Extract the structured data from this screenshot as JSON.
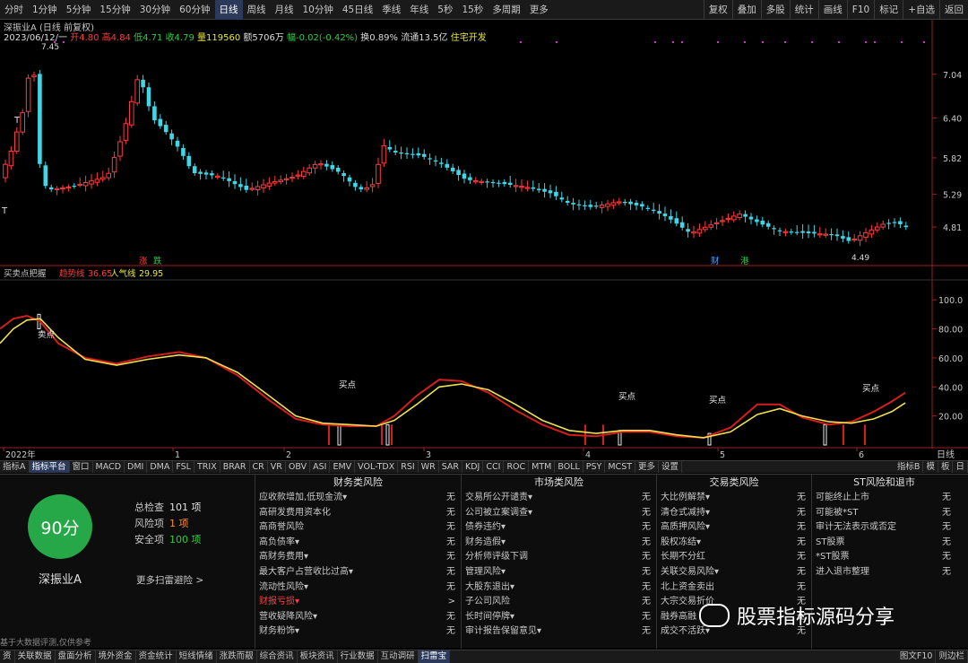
{
  "toolbar": {
    "periods": [
      "分时",
      "1分钟",
      "5分钟",
      "15分钟",
      "30分钟",
      "60分钟",
      "日线",
      "周线",
      "月线",
      "10分钟",
      "45日线",
      "季线",
      "年线",
      "5秒",
      "15秒",
      "多周期",
      "更多"
    ],
    "active_period": "日线",
    "right_tools": [
      "复权",
      "叠加",
      "多股",
      "统计",
      "画线",
      "F10",
      "标记",
      "+自选",
      "返回"
    ]
  },
  "quote": {
    "stock_name": "深振业A",
    "chart_mode": "(日线 前复权)",
    "date": "2023/06/12/一",
    "open": "开4.80",
    "high": "高4.84",
    "low": "低4.71",
    "close": "收4.79",
    "volume": "量119560",
    "amount": "额5706万",
    "change": "幅-0.02(-0.42%)",
    "turnover": "换0.89%",
    "float_cap": "流通13.5亿",
    "sector": "住宅开发"
  },
  "main_chart": {
    "price_ticks": [
      "7.04",
      "6.40",
      "5.82",
      "5.29",
      "4.81"
    ],
    "high_mark": "7.45",
    "low_mark": "4.49",
    "badges": [
      "涨",
      "跌",
      "财",
      "港"
    ],
    "t_marker": "T",
    "x_labels": [
      "2022年",
      "1",
      "2",
      "3",
      "4",
      "5",
      "6"
    ],
    "right_bottom": "日线"
  },
  "indicator": {
    "name": "买卖点把握",
    "line1_label": "趋势线",
    "line1_value": "36.65",
    "line2_label": "人气线",
    "line2_value": "29.95",
    "ticks": [
      "100.0",
      "80.00",
      "60.00",
      "40.00",
      "20.00"
    ],
    "sell_label": "卖点",
    "buy_label": "买点"
  },
  "indicator_tabs": [
    "指标A",
    "指标平台",
    "窗口",
    "MACD",
    "DMI",
    "DMA",
    "FSL",
    "TRIX",
    "BRAR",
    "CR",
    "VR",
    "OBV",
    "ASI",
    "EMV",
    "VOL-TDX",
    "RSI",
    "WR",
    "SAR",
    "KDJ",
    "CCI",
    "ROC",
    "MTM",
    "BOLL",
    "PSY",
    "MCST",
    "更多",
    "设置"
  ],
  "indicator_tabs_active": "指标平台",
  "indicator_right": [
    "指标B",
    "模",
    "板",
    "日"
  ],
  "risk": {
    "score": "90分",
    "stock": "深振业A",
    "total_label": "总检查",
    "total_value": "101 项",
    "risk_label": "风险项",
    "risk_value": "1 项",
    "safe_label": "安全项",
    "safe_value": "100 项",
    "more_scan": "更多扫雷避险 >",
    "disclaimer": "基于大数据评测,仅供参考",
    "columns": [
      {
        "title": "财务类风险",
        "rows": [
          {
            "name": "应收款增加,低现金流▾",
            "value": "无"
          },
          {
            "name": "高研发费用资本化",
            "value": "无"
          },
          {
            "name": "高商誉风险",
            "value": "无"
          },
          {
            "name": "高负债率▾",
            "value": "无"
          },
          {
            "name": "高财务费用▾",
            "value": "无"
          },
          {
            "name": "最大客户占营收比过高▾",
            "value": "无"
          },
          {
            "name": "流动性风险▾",
            "value": "无"
          },
          {
            "name": "财报亏损▾",
            "value": ">"
          },
          {
            "name": "营收疑降风险▾",
            "value": "无"
          },
          {
            "name": "财务粉饰▾",
            "value": "无"
          }
        ]
      },
      {
        "title": "市场类风险",
        "rows": [
          {
            "name": "交易所公开谴责▾",
            "value": "无"
          },
          {
            "name": "公司被立案调查▾",
            "value": "无"
          },
          {
            "name": "债券违约▾",
            "value": "无"
          },
          {
            "name": "财务造假▾",
            "value": "无"
          },
          {
            "name": "分析师评级下调",
            "value": "无"
          },
          {
            "name": "管理风险▾",
            "value": "无"
          },
          {
            "name": "大股东退出▾",
            "value": "无"
          },
          {
            "name": "子公司风险",
            "value": "无"
          },
          {
            "name": "长时间停牌▾",
            "value": "无"
          },
          {
            "name": "审计报告保留意见▾",
            "value": "无"
          }
        ]
      },
      {
        "title": "交易类风险",
        "rows": [
          {
            "name": "大比例解禁▾",
            "value": "无"
          },
          {
            "name": "清仓式减持▾",
            "value": "无"
          },
          {
            "name": "高质押风险▾",
            "value": "无"
          },
          {
            "name": "股权冻结▾",
            "value": "无"
          },
          {
            "name": "长期不分红",
            "value": "无"
          },
          {
            "name": "关联交易风险▾",
            "value": "无"
          },
          {
            "name": "北上资金卖出",
            "value": "无"
          },
          {
            "name": "大宗交易折价",
            "value": "无"
          },
          {
            "name": "融券高融",
            "value": "无"
          },
          {
            "name": "成交不活跃▾",
            "value": "无"
          }
        ]
      },
      {
        "title": "ST风险和退市",
        "rows": [
          {
            "name": "可能终止上市",
            "value": "无"
          },
          {
            "name": "可能被*ST",
            "value": "无"
          },
          {
            "name": "审计无法表示或否定",
            "value": "无"
          },
          {
            "name": "ST股票",
            "value": "无"
          },
          {
            "name": "*ST股票",
            "value": "无"
          },
          {
            "name": "进入退市整理",
            "value": "无"
          }
        ]
      }
    ]
  },
  "watermark": "股票指标源码分享",
  "statusbar": {
    "items": [
      "资",
      "关联数据",
      "盘面分析",
      "境外资金",
      "资金统计",
      "短线情绪",
      "涨跌而靓",
      "综合资讯",
      "板块资讯",
      "行业数据",
      "互动调研",
      "扫雷宝"
    ],
    "active": "扫雷宝",
    "right": [
      "图文F10",
      "则边栏"
    ]
  },
  "colors": {
    "up": "#ff3c3c",
    "down": "#3fd6e6",
    "trend": "#d41e1e",
    "popularity": "#f0e050",
    "score_green": "#27a848"
  }
}
